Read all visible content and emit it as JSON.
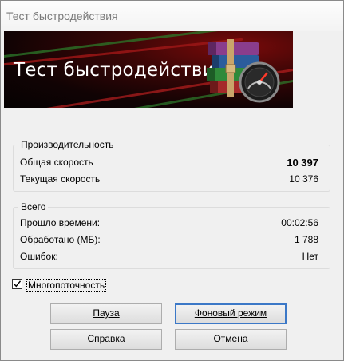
{
  "window": {
    "title": "Тест быстродействия"
  },
  "banner": {
    "title": "Тест быстродействия",
    "icon": "winrar-books-speedometer-icon"
  },
  "performance": {
    "label": "Производительность",
    "overall_label": "Общая скорость",
    "overall_value": "10 397",
    "current_label": "Текущая скорость",
    "current_value": "10 376"
  },
  "total": {
    "label": "Всего",
    "elapsed_label": "Прошло времени:",
    "elapsed_value": "00:02:56",
    "processed_label": "Обработано (МБ):",
    "processed_value": "1 788",
    "errors_label": "Ошибок:",
    "errors_value": "Нет"
  },
  "multithread": {
    "label": "Многопоточность",
    "checked": true
  },
  "buttons": {
    "pause": "Пауза",
    "background": "Фоновый режим",
    "help": "Справка",
    "cancel": "Отмена"
  }
}
